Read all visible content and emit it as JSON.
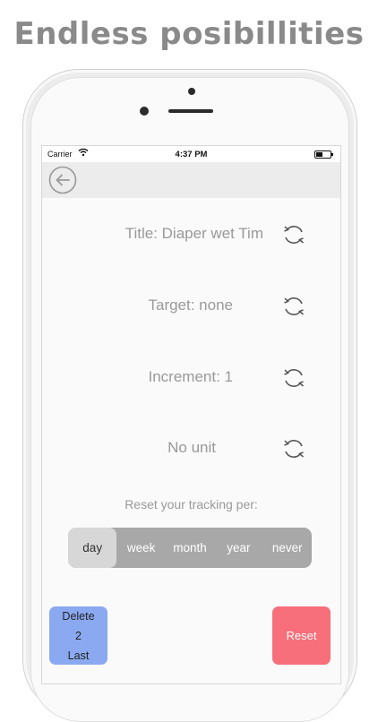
{
  "promo": {
    "headline": "Endless posibillities"
  },
  "status_bar": {
    "carrier": "Carrier",
    "time": "4:37 PM",
    "wifi_icon": "wifi-icon",
    "battery_icon": "battery-icon"
  },
  "nav": {
    "back_icon": "back-arrow-icon"
  },
  "settings": [
    {
      "label": "Title: Diaper wet Tim",
      "action_icon": "refresh-icon"
    },
    {
      "label": "Target: none",
      "action_icon": "refresh-icon"
    },
    {
      "label": "Increment: 1",
      "action_icon": "refresh-icon"
    },
    {
      "label": "No unit",
      "action_icon": "refresh-icon"
    }
  ],
  "reset_period": {
    "caption": "Reset your tracking per:",
    "options": [
      "day",
      "week",
      "month",
      "year",
      "never"
    ],
    "selected": "day"
  },
  "buttons": {
    "delete": {
      "line1": "Delete",
      "line2": "2",
      "line3": "Last"
    },
    "reset": {
      "label": "Reset"
    }
  },
  "colors": {
    "delete_button": "#8aa9f0",
    "reset_button": "#f76f7a",
    "segmented_bg": "#a8a8a8",
    "segmented_selected": "#d7d7d7",
    "label_text": "#999999"
  }
}
